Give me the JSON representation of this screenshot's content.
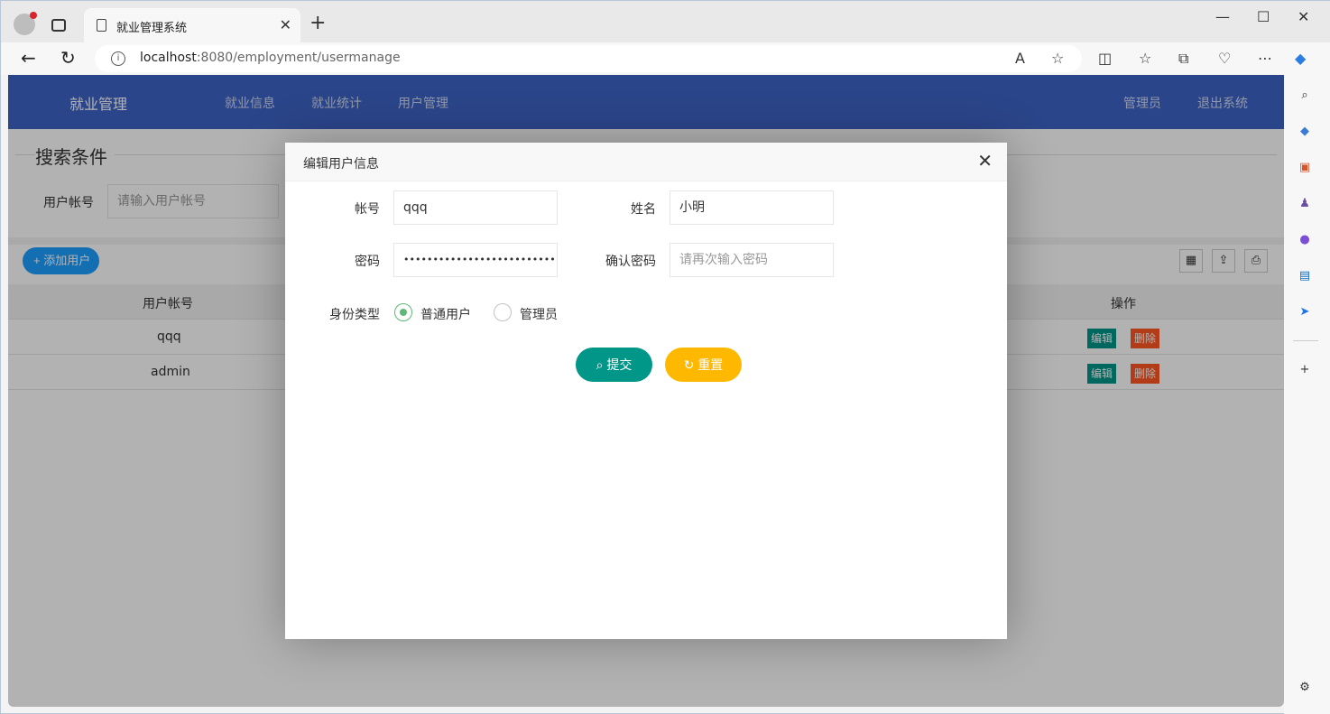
{
  "browser": {
    "tab_title": "就业管理系统",
    "url_host": "localhost",
    "url_path": ":8080/employment/usermanage"
  },
  "app": {
    "brand": "就业管理",
    "nav": [
      "就业信息",
      "就业统计",
      "用户管理"
    ],
    "user": "管理员",
    "logout": "退出系统"
  },
  "search": {
    "legend": "搜索条件",
    "account_label": "用户帐号",
    "account_placeholder": "请输入用户帐号"
  },
  "toolbar": {
    "add_label": "添加用户"
  },
  "table": {
    "col_account": "用户帐号",
    "col_ops": "操作",
    "rows": [
      {
        "account": "qqq"
      },
      {
        "account": "admin"
      }
    ],
    "edit_label": "编辑",
    "delete_label": "删除"
  },
  "modal": {
    "title": "编辑用户信息",
    "account_label": "帐号",
    "account_value": "qqq",
    "name_label": "姓名",
    "name_value": "小明",
    "password_label": "密码",
    "password_value": "••••••••••••••••••••••••••••••••••",
    "confirm_label": "确认密码",
    "confirm_placeholder": "请再次输入密码",
    "role_label": "身份类型",
    "role_options": [
      "普通用户",
      "管理员"
    ],
    "role_selected": "普通用户",
    "submit_label": "提交",
    "reset_label": "重置"
  }
}
